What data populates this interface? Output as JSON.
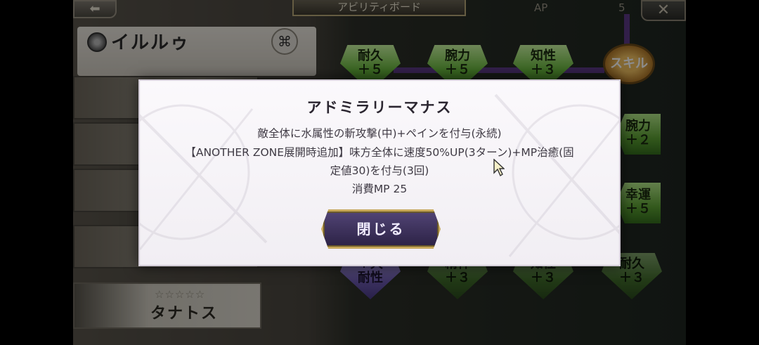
{
  "header": {
    "back_glyph": "⬅",
    "title": "アビリティボード",
    "ap_label": "AP",
    "ap_value": "5",
    "close_glyph": "✕"
  },
  "character": {
    "name": "イルルゥ",
    "link_glyph": "⌘"
  },
  "sub_character": {
    "stars": "☆☆☆☆☆",
    "name": "タナトス"
  },
  "board": {
    "nodes_top": [
      {
        "stat": "耐久",
        "value": "＋５"
      },
      {
        "stat": "腕力",
        "value": "＋５"
      },
      {
        "stat": "知性",
        "value": "＋３"
      }
    ],
    "skill_badge": "スキル",
    "side_nodes": [
      {
        "stat": "腕力",
        "value": "＋２"
      },
      {
        "stat": "幸運",
        "value": "＋５"
      }
    ],
    "nodes_bottom": [
      {
        "stat": "耐性",
        "value": "＋大"
      },
      {
        "stat": "精神",
        "value": "＋３"
      },
      {
        "stat": "知性",
        "value": "＋３"
      },
      {
        "stat": "耐久",
        "value": "＋３"
      }
    ]
  },
  "modal": {
    "title": "アドミラリーマナス",
    "line1": "敵全体に水属性の斬攻撃(中)+ペインを付与(永続)",
    "line2": "【ANOTHER ZONE展開時追加】味方全体に速度50%UP(3ターン)+MP治癒(固",
    "line3": "定値30)を付与(3回)",
    "line4": "消費MP 25",
    "close_button": "閉じる"
  }
}
